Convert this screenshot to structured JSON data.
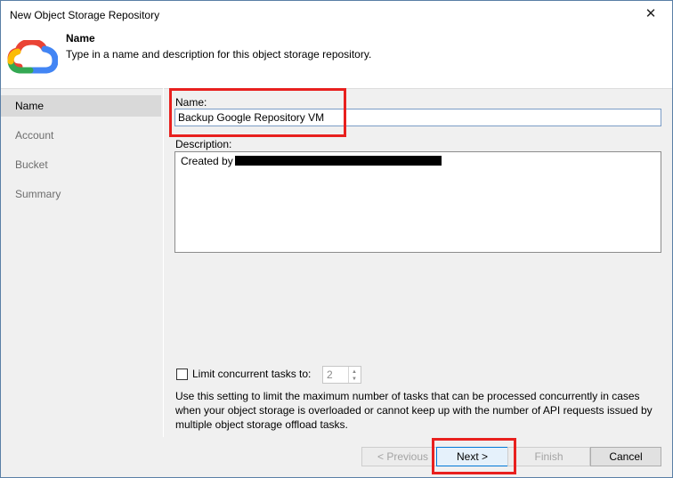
{
  "window": {
    "title": "New Object Storage Repository",
    "close_glyph": "✕"
  },
  "header": {
    "title": "Name",
    "description": "Type in a name and description for this object storage repository.",
    "logo": "google-cloud-icon"
  },
  "nav": {
    "items": [
      {
        "label": "Name",
        "active": true
      },
      {
        "label": "Account",
        "active": false
      },
      {
        "label": "Bucket",
        "active": false
      },
      {
        "label": "Summary",
        "active": false
      }
    ]
  },
  "form": {
    "name_label": "Name:",
    "name_value": "Backup Google Repository VM",
    "description_label": "Description:",
    "description_value": "Created by",
    "limit_label": "Limit concurrent tasks to:",
    "limit_checked": false,
    "limit_value": "2",
    "hint": "Use this setting to limit the maximum number of tasks that can be processed concurrently in cases when your object storage is overloaded or cannot keep up with the number of API requests issued by multiple object storage offload tasks."
  },
  "buttons": {
    "previous": "< Previous",
    "next": "Next >",
    "finish": "Finish",
    "cancel": "Cancel"
  },
  "colors": {
    "highlight": "#e8201e",
    "accent": "#0078d7"
  }
}
